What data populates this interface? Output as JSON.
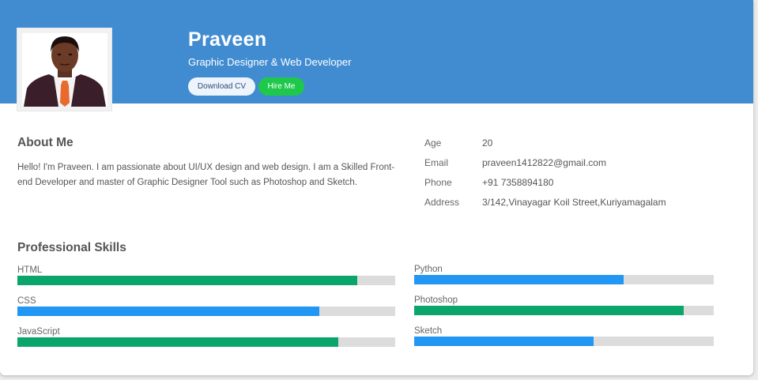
{
  "profile": {
    "name": "Praveen",
    "role": "Graphic Designer & Web Developer",
    "download_cv_label": "Download CV",
    "hire_me_label": "Hire Me"
  },
  "about": {
    "title": "About Me",
    "text": "Hello! I'm Praveen. I am passionate about UI/UX design and web design. I am a Skilled Front-end Developer and master of Graphic Designer Tool such as Photoshop and Sketch."
  },
  "info": [
    {
      "key": "Age",
      "value": "20"
    },
    {
      "key": "Email",
      "value": "praveen1412822@gmail.com"
    },
    {
      "key": "Phone",
      "value": "+91 7358894180"
    },
    {
      "key": "Address",
      "value": "3/142,Vinayagar Koil Street,Kuriyamagalam"
    }
  ],
  "skills": {
    "title": "Professional Skills",
    "left": [
      {
        "name": "HTML",
        "percent": 90,
        "color": "#0aa56a"
      },
      {
        "name": "CSS",
        "percent": 80,
        "color": "#2196f3"
      },
      {
        "name": "JavaScript",
        "percent": 85,
        "color": "#0aa56a"
      }
    ],
    "right": [
      {
        "name": "Python",
        "percent": 70,
        "color": "#2196f3"
      },
      {
        "name": "Photoshop",
        "percent": 90,
        "color": "#0aa56a"
      },
      {
        "name": "Sketch",
        "percent": 60,
        "color": "#2196f3"
      }
    ]
  },
  "colors": {
    "header": "#418cd1",
    "hire_button": "#1ec84a",
    "skill_green": "#0aa56a",
    "skill_blue": "#2196f3",
    "track": "#dcdcdc"
  }
}
